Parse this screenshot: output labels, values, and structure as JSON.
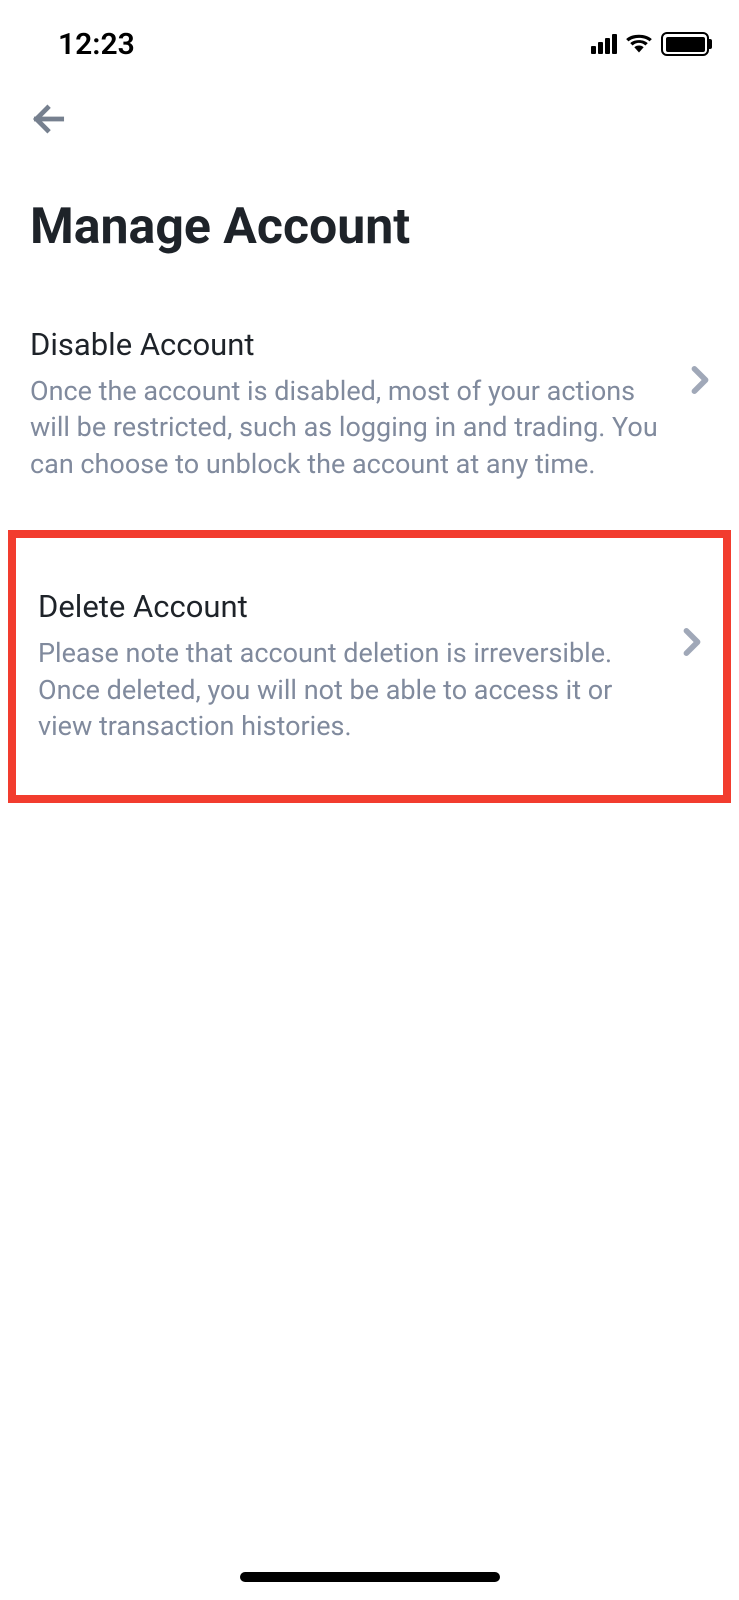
{
  "statusBar": {
    "time": "12:23"
  },
  "page": {
    "title": "Manage Account"
  },
  "menuItems": [
    {
      "title": "Disable Account",
      "description": "Once the account is disabled, most of your actions will be restricted, such as logging in and trading. You can choose to unblock the account at any time."
    },
    {
      "title": "Delete Account",
      "description": "Please note that account deletion is irreversible. Once deleted, you will not be able to access it or view transaction histories."
    }
  ]
}
